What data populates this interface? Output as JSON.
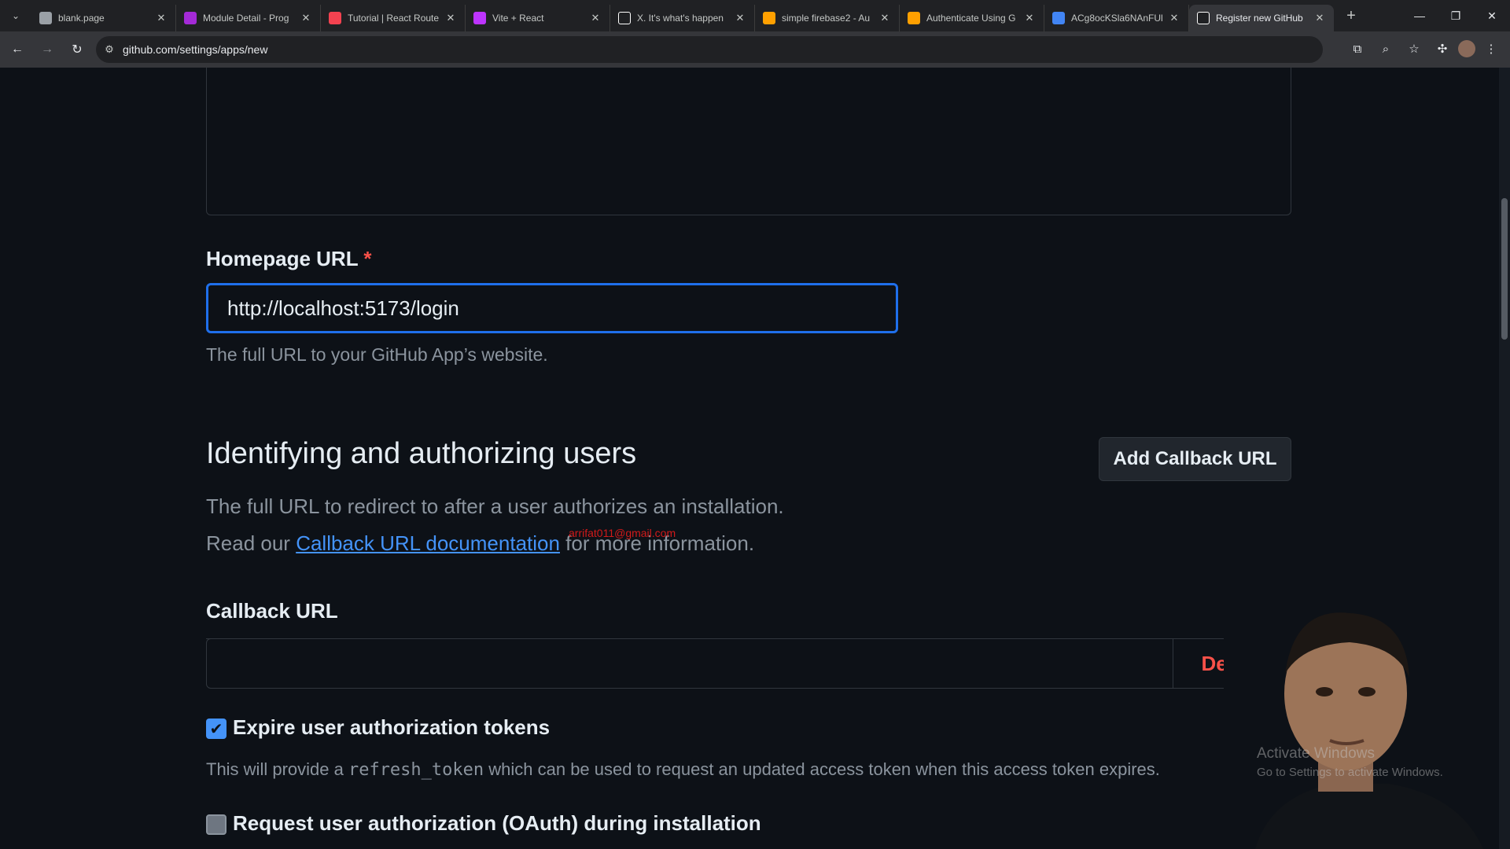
{
  "browser": {
    "tabs": [
      {
        "title": "blank.page",
        "favicon": "page-icon",
        "color": "#9aa0a6",
        "active": false
      },
      {
        "title": "Module Detail - Prog",
        "favicon": "module-icon",
        "color": "#a42ad7",
        "active": false
      },
      {
        "title": "Tutorial | React Route",
        "favicon": "react-router-icon",
        "color": "#f44250",
        "active": false
      },
      {
        "title": "Vite + React",
        "favicon": "vite-icon",
        "color": "#bd34fe",
        "active": false
      },
      {
        "title": "X. It's what's happen",
        "favicon": "x-icon",
        "color": "#ffffff",
        "active": false
      },
      {
        "title": "simple firebase2 - Au",
        "favicon": "firebase-icon",
        "color": "#ffa000",
        "active": false
      },
      {
        "title": "Authenticate Using G",
        "favicon": "firebase-icon",
        "color": "#ffa000",
        "active": false
      },
      {
        "title": "ACg8ocKSla6NAnFUl",
        "favicon": "google-icon",
        "color": "#4285f4",
        "active": false
      },
      {
        "title": "Register new GitHub",
        "favicon": "github-icon",
        "color": "#ffffff",
        "active": true
      }
    ],
    "url": "github.com/settings/apps/new"
  },
  "form": {
    "homepage": {
      "label": "Homepage URL",
      "required_mark": "*",
      "value": "http://localhost:5173/login",
      "hint": "The full URL to your GitHub App’s website."
    },
    "section": {
      "title": "Identifying and authorizing users",
      "add_callback_label": "Add Callback URL",
      "desc_line1": "The full URL to redirect to after a user authorizes an installation.",
      "desc_read": "Read our ",
      "desc_link": "Callback URL documentation",
      "desc_tail": " for more information."
    },
    "callback": {
      "label": "Callback URL",
      "value": "",
      "delete_label": "Delete"
    },
    "expire_tokens": {
      "checked": true,
      "label": "Expire user authorization tokens",
      "note_before": "This will provide a ",
      "note_code": "refresh_token",
      "note_after": " which can be used to request an updated access token when this access token expires."
    },
    "request_oauth": {
      "checked": false,
      "label": "Request user authorization (OAuth) during installation"
    }
  },
  "overlay": {
    "email": "arrifat011@gmail.com",
    "activate_title": "Activate Windows",
    "activate_sub": "Go to Settings to activate Windows."
  }
}
